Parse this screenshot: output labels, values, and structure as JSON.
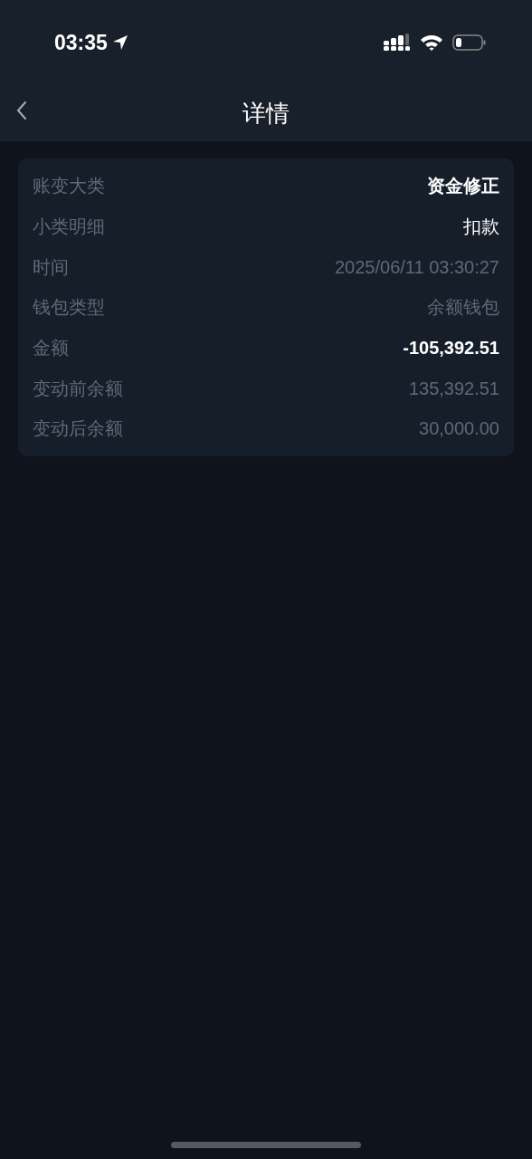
{
  "status_bar": {
    "time": "03:35"
  },
  "nav": {
    "title": "详情"
  },
  "details": [
    {
      "label": "账变大类",
      "value": "资金修正",
      "kind": "strong"
    },
    {
      "label": "小类明细",
      "value": "扣款",
      "kind": "bright"
    },
    {
      "label": "时间",
      "value": "2025/06/11 03:30:27",
      "kind": "muted"
    },
    {
      "label": "钱包类型",
      "value": "余额钱包",
      "kind": "muted"
    },
    {
      "label": "金额",
      "value": "-105,392.51",
      "kind": "strong"
    },
    {
      "label": "变动前余额",
      "value": "135,392.51",
      "kind": "muted"
    },
    {
      "label": "变动后余额",
      "value": "30,000.00",
      "kind": "muted"
    }
  ]
}
